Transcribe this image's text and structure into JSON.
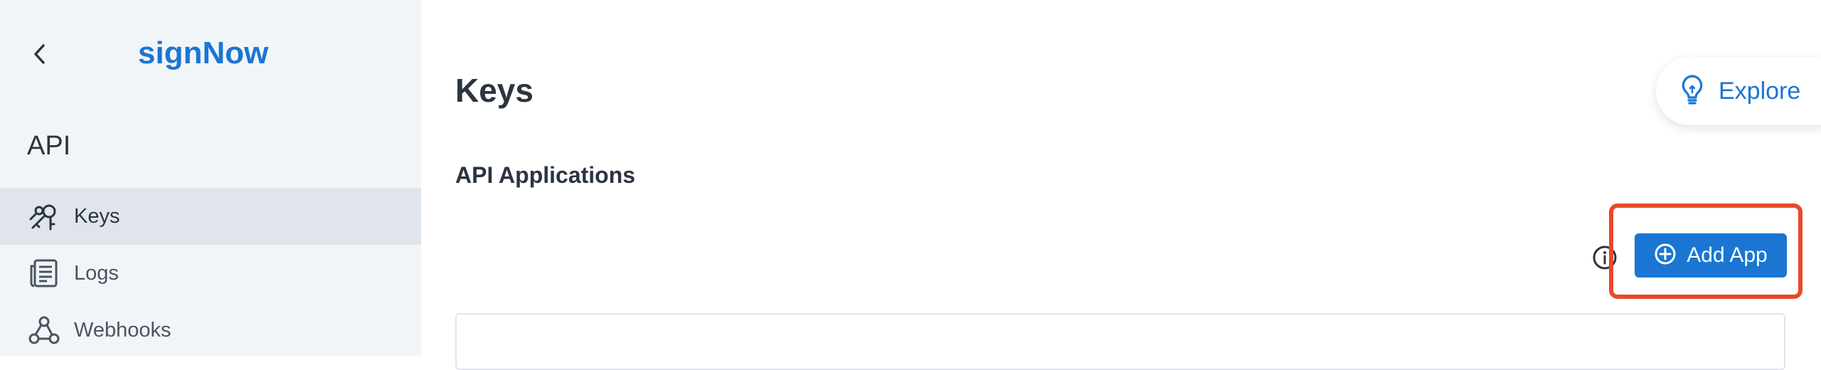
{
  "sidebar": {
    "logo": "signNow",
    "section_title": "API",
    "items": [
      {
        "label": "Keys",
        "icon": "keys-icon",
        "active": true
      },
      {
        "label": "Logs",
        "icon": "logs-icon",
        "active": false
      },
      {
        "label": "Webhooks",
        "icon": "webhooks-icon",
        "active": false
      }
    ]
  },
  "main": {
    "title": "Keys",
    "subtitle": "API Applications",
    "explore_label": "Explore",
    "add_app_label": "Add App"
  },
  "colors": {
    "accent": "#1a76d2",
    "highlight": "#e8482a",
    "sidebar_bg": "#f2f5f8",
    "active_bg": "#e0e5eb"
  }
}
